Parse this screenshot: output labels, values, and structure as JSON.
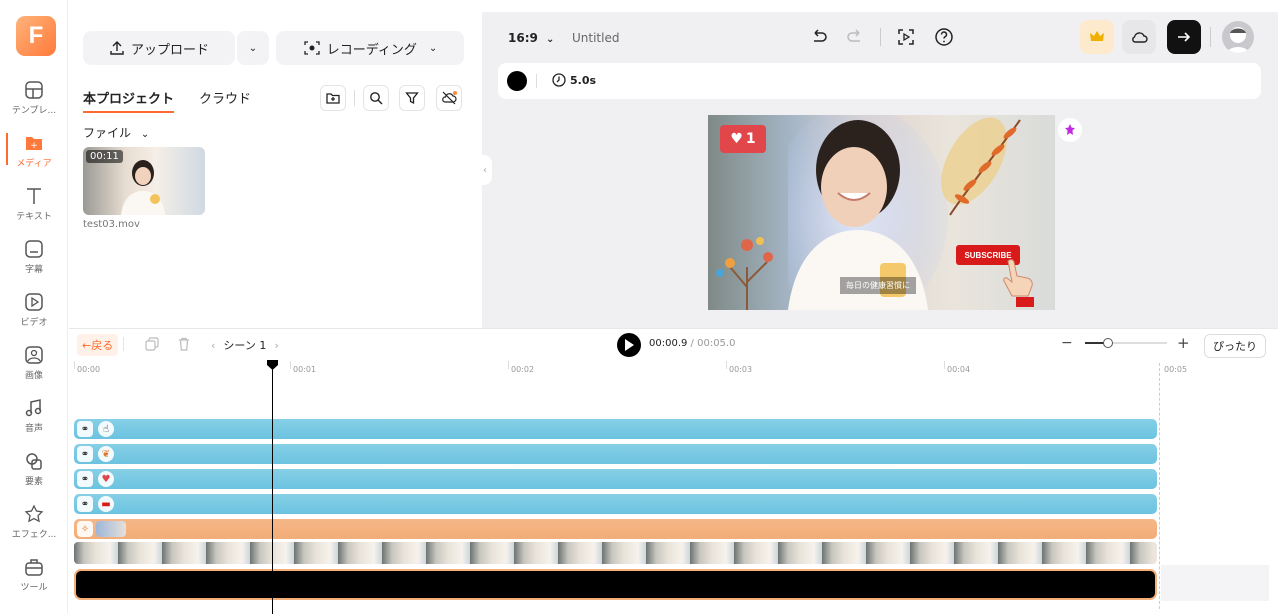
{
  "rail": {
    "logo": "F",
    "items": [
      {
        "label": "テンプレ...",
        "icon": "template-icon"
      },
      {
        "label": "メディア",
        "icon": "media-icon"
      },
      {
        "label": "テキスト",
        "icon": "text-icon"
      },
      {
        "label": "字幕",
        "icon": "subtitle-icon"
      },
      {
        "label": "ビデオ",
        "icon": "video-icon"
      },
      {
        "label": "画像",
        "icon": "image-icon"
      },
      {
        "label": "音声",
        "icon": "audio-icon"
      },
      {
        "label": "要素",
        "icon": "element-icon"
      },
      {
        "label": "エフェク...",
        "icon": "effect-icon"
      },
      {
        "label": "ツール",
        "icon": "tool-icon"
      }
    ]
  },
  "media": {
    "upload_label": "アップロード",
    "record_label": "レコーディング",
    "tab_project": "本プロジェクト",
    "tab_cloud": "クラウド",
    "folder_label": "ファイル",
    "file": {
      "duration": "00:11",
      "name": "test03.mov"
    }
  },
  "stage": {
    "aspect": "16:9",
    "title": "Untitled",
    "duration": "5.0s",
    "likes": "1",
    "subscribe": "SUBSCRIBE",
    "caption": "毎日の健康習慣に"
  },
  "timeline": {
    "back_label": "←戻る",
    "scene_label": "シーン 1",
    "time_current": "00:00.9",
    "time_total": "/ 00:05.0",
    "fit_label": "ぴったり",
    "ruler": [
      "00:00",
      "00:01",
      "00:02",
      "00:03",
      "00:04",
      "00:05"
    ]
  },
  "colors": {
    "accent": "#ff6a2f",
    "track_blue": "#79c9e4",
    "track_orange": "#f3b27f"
  }
}
